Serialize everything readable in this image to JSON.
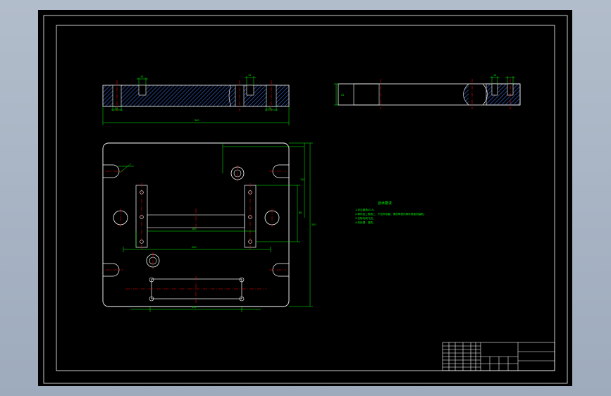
{
  "drawing": {
    "background": "#000000",
    "colors": {
      "outline": "#ffffff",
      "dimension": "#00ff00",
      "centerline": "#ff0000",
      "hatch": "#3a6ad8",
      "border": "#ffffff"
    },
    "notes": {
      "title": "技术要求",
      "lines": [
        "1.未注倒角C0.5。",
        "2.零件加工表面上，不应有划痕、擦伤等损伤零件表面的缺陷。",
        "3.去除毛刺飞边。",
        "4.热处理：调质。"
      ]
    },
    "dimensions": {
      "top_length": "300",
      "slot_w1": "10",
      "slot_w2": "10",
      "slot_w3": "10",
      "bot_w1": "20",
      "bot_w2": "20",
      "plan_w1": "100",
      "plan_w2": "200",
      "plan_w3": "150",
      "plan_h1": "120",
      "plan_h2": "250",
      "plan_h3": "80",
      "side_h": "25"
    }
  }
}
